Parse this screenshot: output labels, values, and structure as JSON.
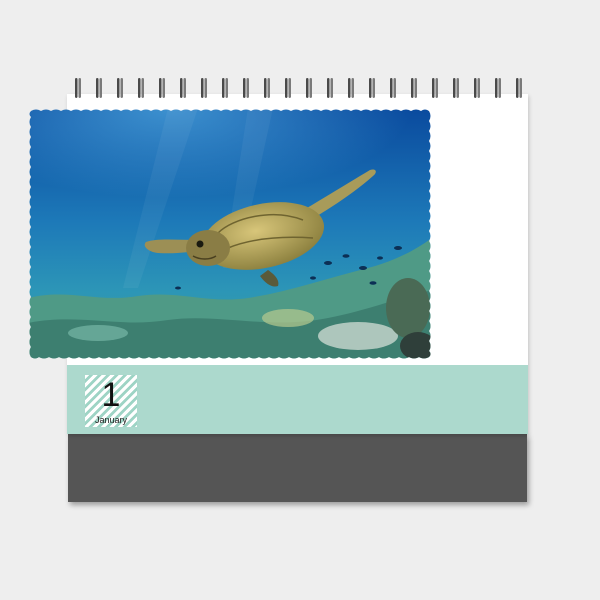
{
  "calendar": {
    "date": {
      "day": "1",
      "month": "January"
    },
    "photo": {
      "subject": "turtle-photo"
    },
    "colors": {
      "background": "#eeeeee",
      "strip": "#acd9cd",
      "base": "#555555",
      "ocean_top": "#0a4ea8",
      "ocean_mid": "#2a8fbf",
      "seabed": "#5aa89a"
    }
  }
}
